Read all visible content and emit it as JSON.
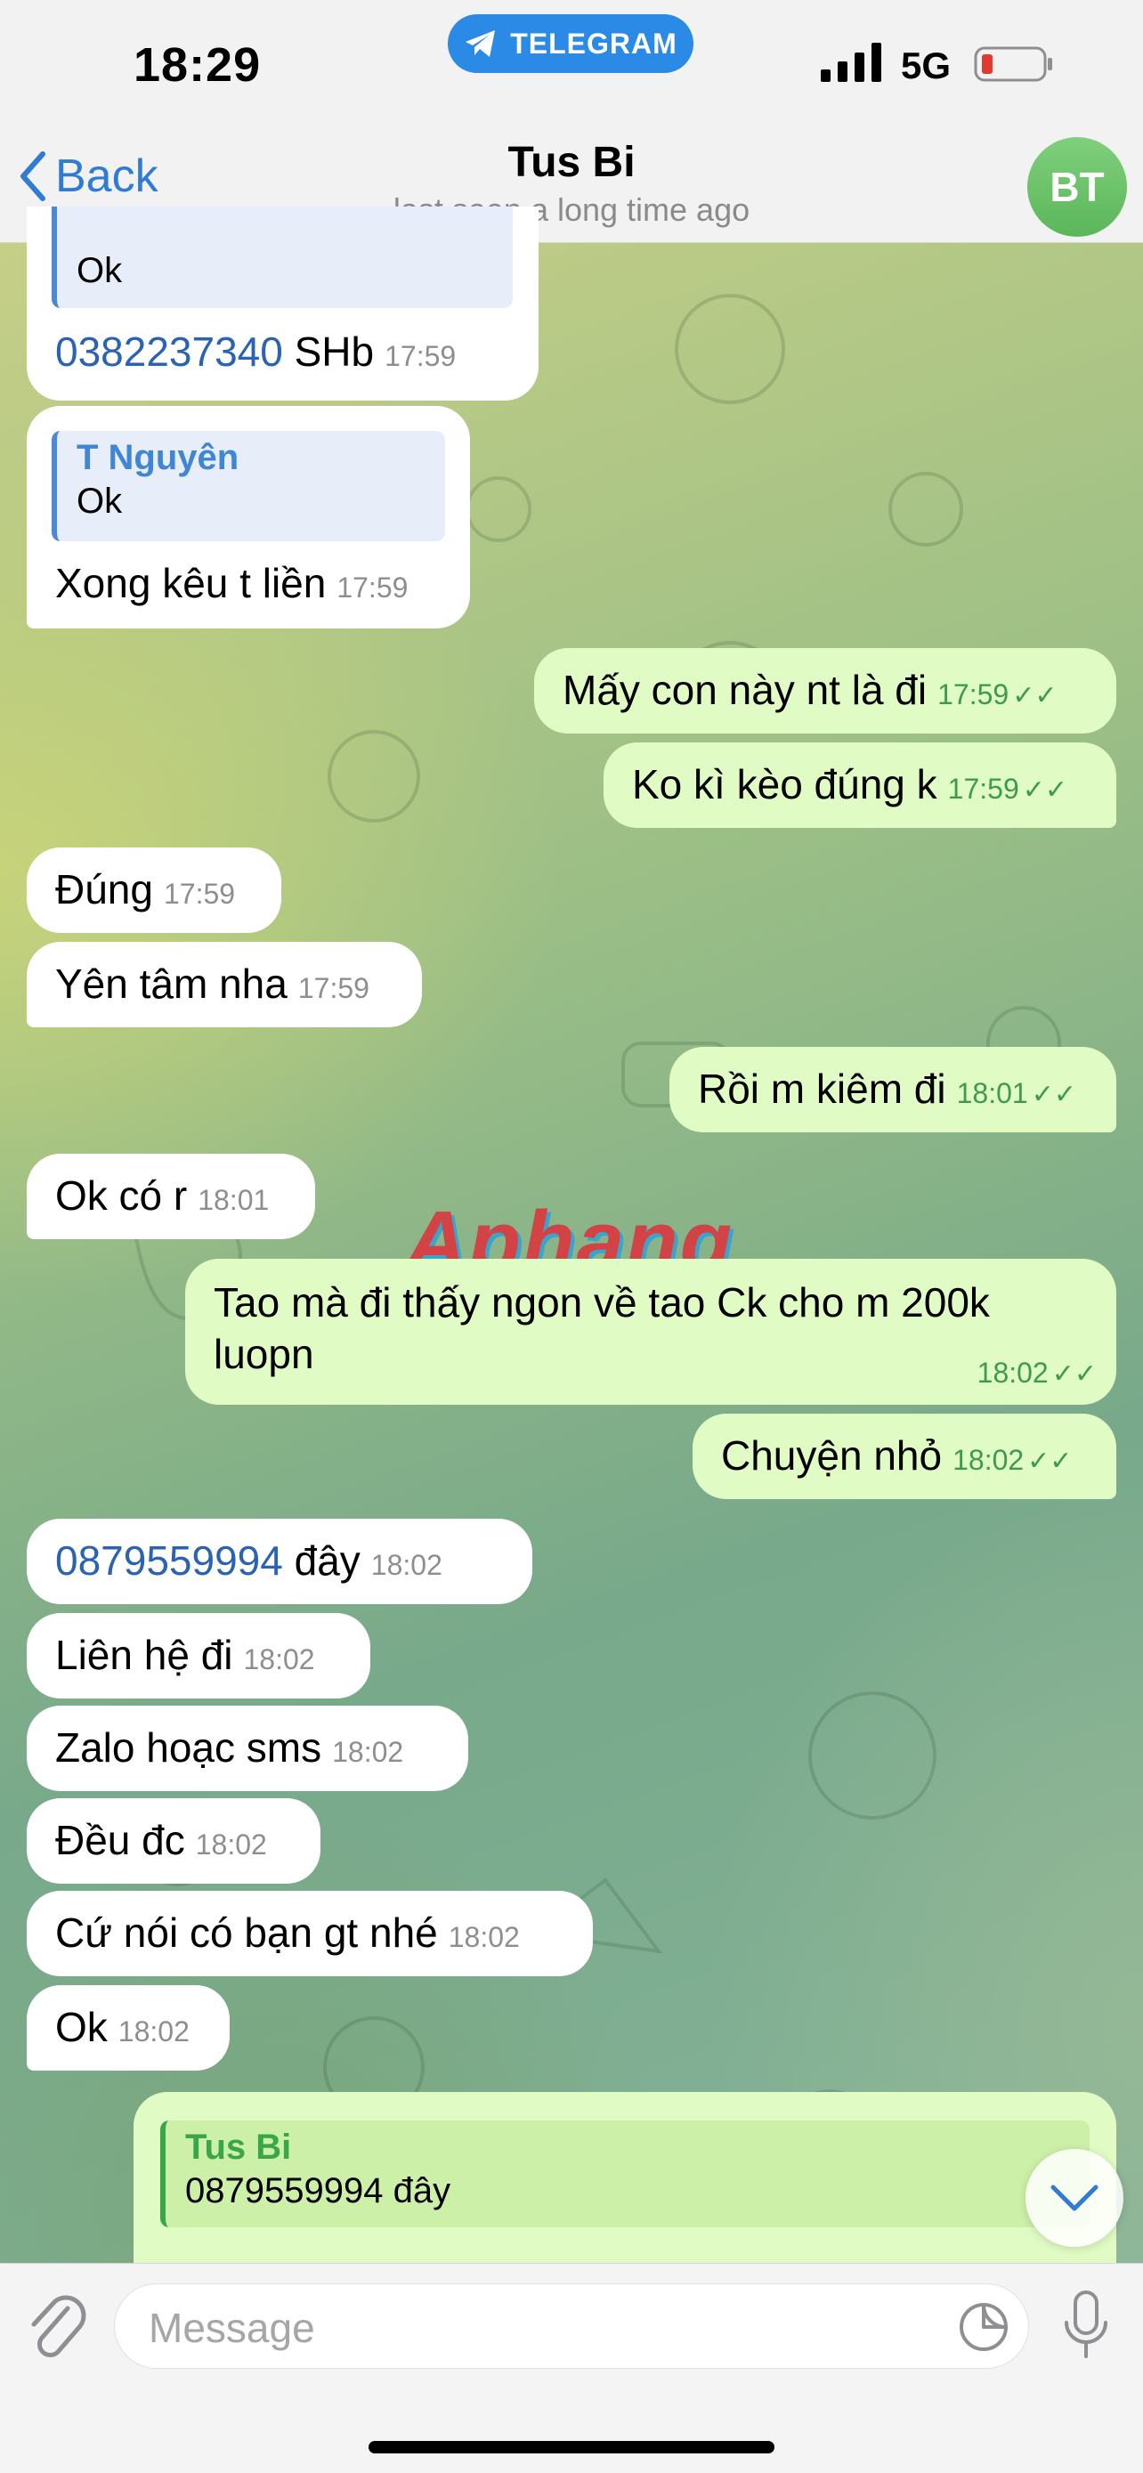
{
  "status_bar": {
    "time": "18:29",
    "app_pill": "TELEGRAM",
    "network": "5G"
  },
  "header": {
    "back_label": "Back",
    "title": "Tus Bi",
    "subtitle": "last seen a long time ago",
    "avatar_initials": "BT"
  },
  "messages": [
    {
      "quote_text": "Ok",
      "phone": "0382237340",
      "text": " SHb",
      "time": "17:59"
    },
    {
      "quote_name": "T Nguyên",
      "quote_text": "Ok",
      "text": "Xong kêu t liền",
      "time": "17:59"
    },
    {
      "text": "Mấy con này nt là đi",
      "time": "17:59"
    },
    {
      "text": "Ko kì kèo đúng k",
      "time": "17:59"
    },
    {
      "text": "Đúng",
      "time": "17:59"
    },
    {
      "text": "Yên tâm nha",
      "time": "17:59"
    },
    {
      "text": "Rồi m kiêm đi",
      "time": "18:01"
    },
    {
      "text": "Ok có r",
      "time": "18:01"
    },
    {
      "text_line1": "Tao mà đi thấy ngon về tao Ck cho m 200k",
      "text_line2": "luopn",
      "time": "18:02"
    },
    {
      "text": "Chuyện nhỏ",
      "time": "18:02"
    },
    {
      "phone": "0879559994",
      "text": " đây",
      "time": "18:02"
    },
    {
      "text": "Liên hệ đi",
      "time": "18:02"
    },
    {
      "text": "Zalo hoạc sms",
      "time": "18:02"
    },
    {
      "text": "Đều đc",
      "time": "18:02"
    },
    {
      "text": "Cứ nói có bạn gt nhé",
      "time": "18:02"
    },
    {
      "text": "Ok",
      "time": "18:02"
    },
    {
      "quote_name": "Tus Bi",
      "quote_text": "0879559994 đây"
    }
  ],
  "watermark": "Aphang",
  "input": {
    "placeholder": "Message"
  },
  "colors": {
    "accent": "#2f7bd6",
    "incoming_bubble": "#ffffff",
    "outgoing_bubble": "#e1fbc4",
    "time_outgoing": "#3e9b4c"
  }
}
